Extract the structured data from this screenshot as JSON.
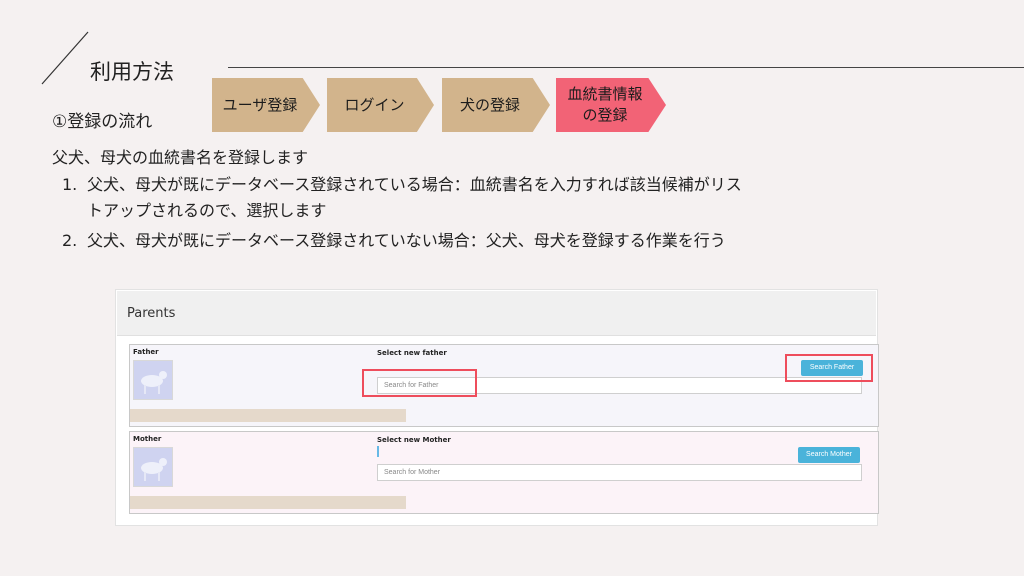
{
  "header": {
    "title": "利用方法"
  },
  "section": {
    "heading": "①登録の流れ"
  },
  "steps": [
    {
      "label": "ユーザ登録",
      "active": false
    },
    {
      "label": "ログイン",
      "active": false
    },
    {
      "label": "犬の登録",
      "active": false
    },
    {
      "label": "血統書情報\nの登録",
      "active": true
    }
  ],
  "body": {
    "intro": "父犬、母犬の血統書名を登録します",
    "items": [
      {
        "num": "1.",
        "text": "父犬、母犬が既にデータベース登録されている場合：血統書名を入力すれば該当候補がリス\nトアップされるので、選択します"
      },
      {
        "num": "2.",
        "text": "父犬、母犬が既にデータベース登録されていない場合：父犬、母犬を登録する作業を行う"
      }
    ]
  },
  "screenshot": {
    "title": "Parents",
    "father": {
      "label": "Father",
      "select_label": "Select new father",
      "search_placeholder": "Search for Father",
      "button": "Search Father"
    },
    "mother": {
      "label": "Mother",
      "select_label": "Select new Mother",
      "search_placeholder": "Search for Mother",
      "button": "Search Mother"
    }
  },
  "colors": {
    "step": "#d2b48c",
    "step_active": "#f26376",
    "highlight": "#ee4d5c",
    "button": "#4ab3da"
  }
}
